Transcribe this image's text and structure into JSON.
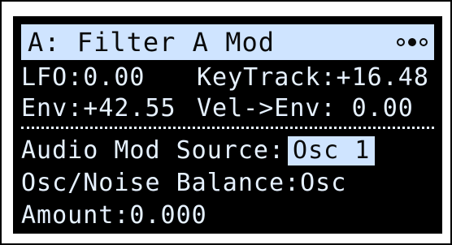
{
  "title_bar": {
    "title": "A: Filter A Mod",
    "page_indicator": [
      "empty",
      "filled",
      "empty"
    ]
  },
  "params": {
    "lfo": "LFO:0.00",
    "keytrack": "KeyTrack:+16.48",
    "env": "Env:+42.55",
    "vel_env": "Vel->Env:  0.00"
  },
  "audio_mod": {
    "source_label": "Audio Mod Source:",
    "source_value": "Osc 1",
    "balance": "Osc/Noise Balance:Osc",
    "amount": "Amount:0.000"
  },
  "colors": {
    "lcd_background": "#000000",
    "lcd_text": "#e6f1ff",
    "highlight": "#cfe4ff"
  }
}
